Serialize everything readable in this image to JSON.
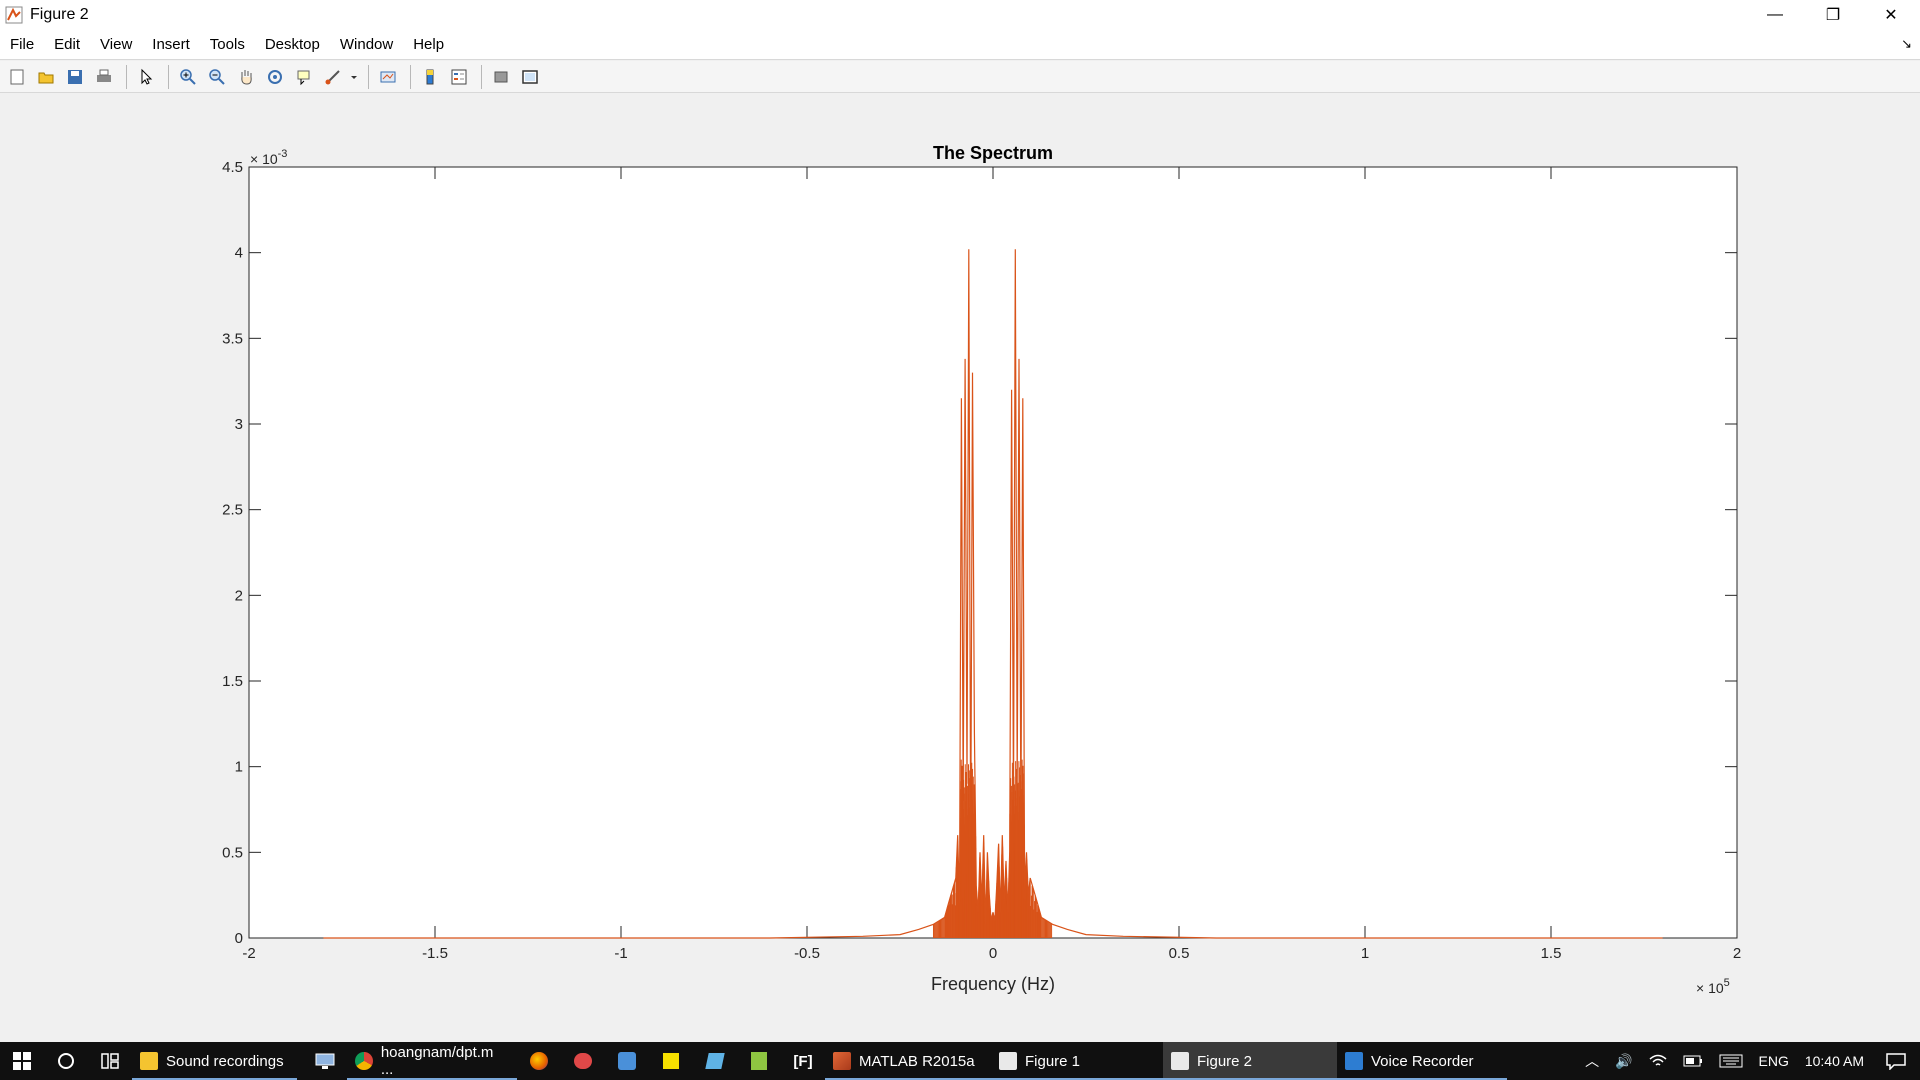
{
  "window": {
    "title": "Figure 2"
  },
  "window_controls": {
    "minimize": "—",
    "maximize": "❐",
    "close": "✕"
  },
  "menu": [
    "File",
    "Edit",
    "View",
    "Insert",
    "Tools",
    "Desktop",
    "Window",
    "Help"
  ],
  "toolbar": {
    "buttons": [
      "new-figure-icon",
      "open-file-icon",
      "save-icon",
      "print-icon",
      "pointer-icon",
      "zoom-in-icon",
      "zoom-out-icon",
      "pan-hand-icon",
      "rotate-3d-icon",
      "data-cursor-icon",
      "brush-icon",
      "link-plot-icon",
      "colorbar-icon",
      "legend-icon",
      "hide-plot-tools-icon",
      "show-plot-tools-icon"
    ]
  },
  "chart_data": {
    "type": "line",
    "title": "The Spectrum",
    "xlabel": "Frequency (Hz)",
    "ylabel": "",
    "xlim": [
      -2,
      2
    ],
    "ylim": [
      0,
      4.5
    ],
    "x_multiplier_label": "× 10",
    "x_multiplier_exp": "5",
    "y_multiplier_label": "× 10",
    "y_multiplier_exp": "-3",
    "x_ticks": [
      "-2",
      "-1.5",
      "-1",
      "-0.5",
      "0",
      "0.5",
      "1",
      "1.5",
      "2"
    ],
    "y_ticks": [
      "0",
      "0.5",
      "1",
      "1.5",
      "2",
      "2.5",
      "3",
      "3.5",
      "4",
      "4.5"
    ],
    "line_color": "#d95319",
    "series": [
      {
        "x": [
          -1.8,
          -0.6,
          -0.35,
          -0.25,
          -0.2,
          -0.16,
          -0.13,
          -0.12,
          -0.1,
          -0.095,
          -0.09,
          -0.085,
          -0.08,
          -0.075,
          -0.07,
          -0.065,
          -0.06,
          -0.055,
          -0.05,
          -0.045,
          -0.04,
          -0.035,
          -0.03,
          -0.025,
          -0.02,
          -0.015,
          -0.01,
          -0.005,
          0,
          0.005,
          0.01,
          0.015,
          0.02,
          0.025,
          0.03,
          0.035,
          0.04,
          0.045,
          0.05,
          0.055,
          0.06,
          0.065,
          0.07,
          0.075,
          0.08,
          0.085,
          0.09,
          0.095,
          0.1,
          0.12,
          0.13,
          0.16,
          0.2,
          0.25,
          0.35,
          0.6,
          1.8
        ],
        "y": [
          0.0,
          0.0,
          0.01,
          0.02,
          0.05,
          0.08,
          0.12,
          0.2,
          0.35,
          0.6,
          0.2,
          3.15,
          0.8,
          3.38,
          0.9,
          4.02,
          0.5,
          3.3,
          1.2,
          0.3,
          0.15,
          0.5,
          0.2,
          0.6,
          0.08,
          0.5,
          0.25,
          0.1,
          0.15,
          0.1,
          0.3,
          0.55,
          0.15,
          0.6,
          0.2,
          0.45,
          0.15,
          0.5,
          3.2,
          0.8,
          4.02,
          0.9,
          3.38,
          0.7,
          3.15,
          0.3,
          0.5,
          0.25,
          0.35,
          0.2,
          0.12,
          0.08,
          0.05,
          0.02,
          0.01,
          0.0,
          0.0
        ]
      }
    ],
    "grid": false
  },
  "taskbar": {
    "apps": [
      {
        "label": "Sound recordings",
        "active": false
      },
      {
        "label": "hoangnam/dpt.m ...",
        "active": false
      },
      {
        "label": "MATLAB R2015a",
        "active": false
      },
      {
        "label": "Figure 1",
        "active": false
      },
      {
        "label": "Figure 2",
        "active": true
      },
      {
        "label": "Voice Recorder",
        "active": false
      }
    ],
    "tray": {
      "language": "ENG",
      "time": "10:40 AM"
    }
  }
}
